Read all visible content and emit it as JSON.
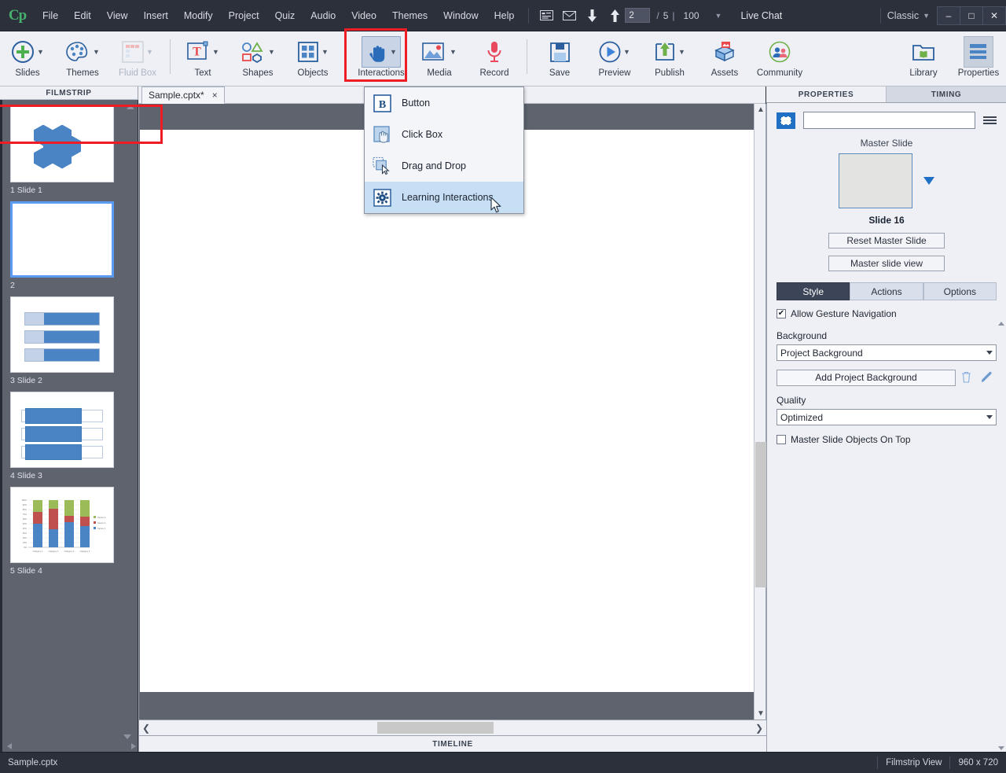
{
  "app": {
    "logo": "Cp"
  },
  "menubar": {
    "items": [
      "File",
      "Edit",
      "View",
      "Insert",
      "Modify",
      "Project",
      "Quiz",
      "Audio",
      "Video",
      "Themes",
      "Window",
      "Help"
    ],
    "slide_current": "2",
    "slide_sep": "/",
    "slide_total": "5",
    "divider": "|",
    "zoom": "100",
    "live_chat": "Live Chat",
    "workspace": "Classic",
    "icons": {
      "captions": "closed-caption-icon",
      "mail": "mail-icon",
      "down": "arrow-down-icon",
      "up": "arrow-up-icon",
      "zoom_caret": "chevron-down-icon",
      "classic_caret": "chevron-down-icon"
    },
    "window_buttons": {
      "minimize": "–",
      "maximize": "□",
      "close": "✕"
    }
  },
  "toolbar": {
    "buttons": [
      {
        "label": "Slides",
        "icon": "plus-circle-icon",
        "caret": true,
        "disabled": false,
        "active": false
      },
      {
        "label": "Themes",
        "icon": "palette-icon",
        "caret": true,
        "disabled": false,
        "active": false
      },
      {
        "label": "Fluid Box",
        "icon": "fluidbox-icon",
        "caret": true,
        "disabled": true,
        "active": false
      },
      {
        "label": "Text",
        "icon": "text-icon",
        "caret": true,
        "disabled": false,
        "active": false
      },
      {
        "label": "Shapes",
        "icon": "shapes-icon",
        "caret": true,
        "disabled": false,
        "active": false
      },
      {
        "label": "Objects",
        "icon": "objects-icon",
        "caret": true,
        "disabled": false,
        "active": false
      },
      {
        "label": "Interactions",
        "icon": "hand-pointer-icon",
        "caret": true,
        "disabled": false,
        "active": true
      },
      {
        "label": "Media",
        "icon": "image-icon",
        "caret": true,
        "disabled": false,
        "active": false
      },
      {
        "label": "Record",
        "icon": "microphone-icon",
        "caret": false,
        "disabled": false,
        "active": false
      },
      {
        "label": "Save",
        "icon": "floppy-disk-icon",
        "caret": false,
        "disabled": false,
        "active": false
      },
      {
        "label": "Preview",
        "icon": "play-circle-icon",
        "caret": true,
        "disabled": false,
        "active": false
      },
      {
        "label": "Publish",
        "icon": "publish-icon",
        "caret": true,
        "disabled": false,
        "active": false
      },
      {
        "label": "Assets",
        "icon": "assets-box-icon",
        "caret": false,
        "disabled": false,
        "active": false
      },
      {
        "label": "Community",
        "icon": "community-icon",
        "caret": false,
        "disabled": false,
        "active": false
      },
      {
        "label": "Library",
        "icon": "library-folder-icon",
        "caret": false,
        "disabled": false,
        "active": false
      },
      {
        "label": "Properties",
        "icon": "properties-icon",
        "caret": false,
        "disabled": false,
        "active": false
      }
    ],
    "highlight_color": "#ee1c25"
  },
  "dropdown": {
    "items": [
      {
        "label": "Button",
        "icon": "button-b-icon",
        "selected": false
      },
      {
        "label": "Click Box",
        "icon": "click-box-icon",
        "selected": false
      },
      {
        "label": "Drag and Drop",
        "icon": "drag-and-drop-icon",
        "selected": false
      },
      {
        "label": "Learning Interactions",
        "icon": "gear-icon",
        "selected": true
      }
    ],
    "highlight_color": "#ee1c25"
  },
  "filmstrip": {
    "title": "FILMSTRIP",
    "slides": [
      {
        "label": "1 Slide 1",
        "art": "hex",
        "selected": false
      },
      {
        "label": "2",
        "art": "blank",
        "selected": true
      },
      {
        "label": "3 Slide 2",
        "art": "bars",
        "selected": false
      },
      {
        "label": "4 Slide 3",
        "art": "lines",
        "selected": false
      },
      {
        "label": "5 Slide 4",
        "art": "chart",
        "selected": false
      }
    ]
  },
  "document": {
    "tab_label": "Sample.cptx*",
    "close": "×"
  },
  "timeline": {
    "title": "TIMELINE"
  },
  "properties": {
    "tabs": [
      {
        "label": "PROPERTIES",
        "active": true
      },
      {
        "label": "TIMING",
        "active": false
      }
    ],
    "name_value": "",
    "name_placeholder": "",
    "master_slide_label": "Master Slide",
    "master_slide_name": "Slide 16",
    "reset_master_slide": "Reset Master Slide",
    "master_slide_view": "Master slide view",
    "segments": [
      {
        "label": "Style",
        "active": true
      },
      {
        "label": "Actions",
        "active": false
      },
      {
        "label": "Options",
        "active": false
      }
    ],
    "allow_gesture_navigation": {
      "label": "Allow Gesture Navigation",
      "checked": true,
      "mark": "✔"
    },
    "background_label": "Background",
    "background_value": "Project Background",
    "add_project_background": "Add Project Background",
    "delete_icon": "trash-icon",
    "edit_icon": "pencil-icon",
    "quality_label": "Quality",
    "quality_value": "Optimized",
    "master_objects_on_top": {
      "label": "Master Slide Objects On Top",
      "checked": false,
      "mark": ""
    }
  },
  "statusbar": {
    "file": "Sample.cptx",
    "view_mode": "Filmstrip View",
    "dimensions": "960 x 720"
  },
  "chart_data": {
    "type": "bar",
    "title": "",
    "categories": [
      "Category 1",
      "Category 2",
      "Category 3",
      "Category 4"
    ],
    "series": [
      {
        "name": "Series 1",
        "values": [
          50,
          38,
          54,
          45
        ]
      },
      {
        "name": "Series 2",
        "values": [
          25,
          43,
          13,
          20
        ]
      },
      {
        "name": "Series 3",
        "values": [
          25,
          19,
          33,
          35
        ]
      }
    ],
    "ylim": [
      0,
      100
    ],
    "ytick_labels": [
      "0%",
      "10%",
      "20%",
      "30%",
      "40%",
      "50%",
      "60%",
      "70%",
      "80%",
      "90%",
      "100%"
    ],
    "legend": [
      "Series 3",
      "Series 2",
      "Series 1"
    ],
    "legend_position": "right",
    "grid": true,
    "colors": [
      "#4a84c4",
      "#c0504d",
      "#9bbb59"
    ]
  }
}
